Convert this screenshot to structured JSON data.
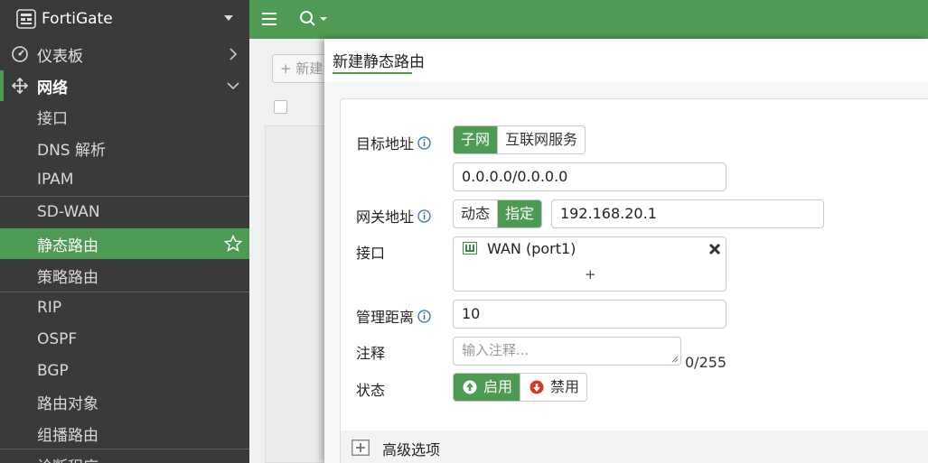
{
  "brand": {
    "name": "FortiGate"
  },
  "sidebar": {
    "items": [
      {
        "label": "仪表板"
      },
      {
        "label": "网络"
      },
      {
        "label": "接口"
      },
      {
        "label": "DNS 解析"
      },
      {
        "label": "IPAM"
      },
      {
        "label": "SD-WAN"
      },
      {
        "label": "静态路由"
      },
      {
        "label": "策略路由"
      },
      {
        "label": "RIP"
      },
      {
        "label": "OSPF"
      },
      {
        "label": "BGP"
      },
      {
        "label": "路由对象"
      },
      {
        "label": "组播路由"
      },
      {
        "label": "诊断程序"
      }
    ]
  },
  "background_page": {
    "new_button": "+ 新建"
  },
  "dialog": {
    "title": "新建静态路由",
    "destination": {
      "label": "目标地址",
      "options": [
        "子网",
        "互联网服务"
      ],
      "selected": "子网",
      "value": "0.0.0.0/0.0.0.0"
    },
    "gateway": {
      "label": "网关地址",
      "options": [
        "动态",
        "指定"
      ],
      "selected": "指定",
      "value": "192.168.20.1"
    },
    "interface": {
      "label": "接口",
      "value": "WAN (port1)",
      "add": "+"
    },
    "distance": {
      "label": "管理距离",
      "value": "10"
    },
    "comment": {
      "label": "注释",
      "placeholder": "输入注释...",
      "counter": "0/255"
    },
    "status": {
      "label": "状态",
      "enable": "启用",
      "disable": "禁用",
      "selected": "启用"
    },
    "advanced": {
      "label": "高级选项"
    }
  },
  "colors": {
    "accent": "#4d9a52",
    "sidebar_bg": "#3a3a3a",
    "topbar": "#4f9b54",
    "danger": "#d9352b"
  }
}
